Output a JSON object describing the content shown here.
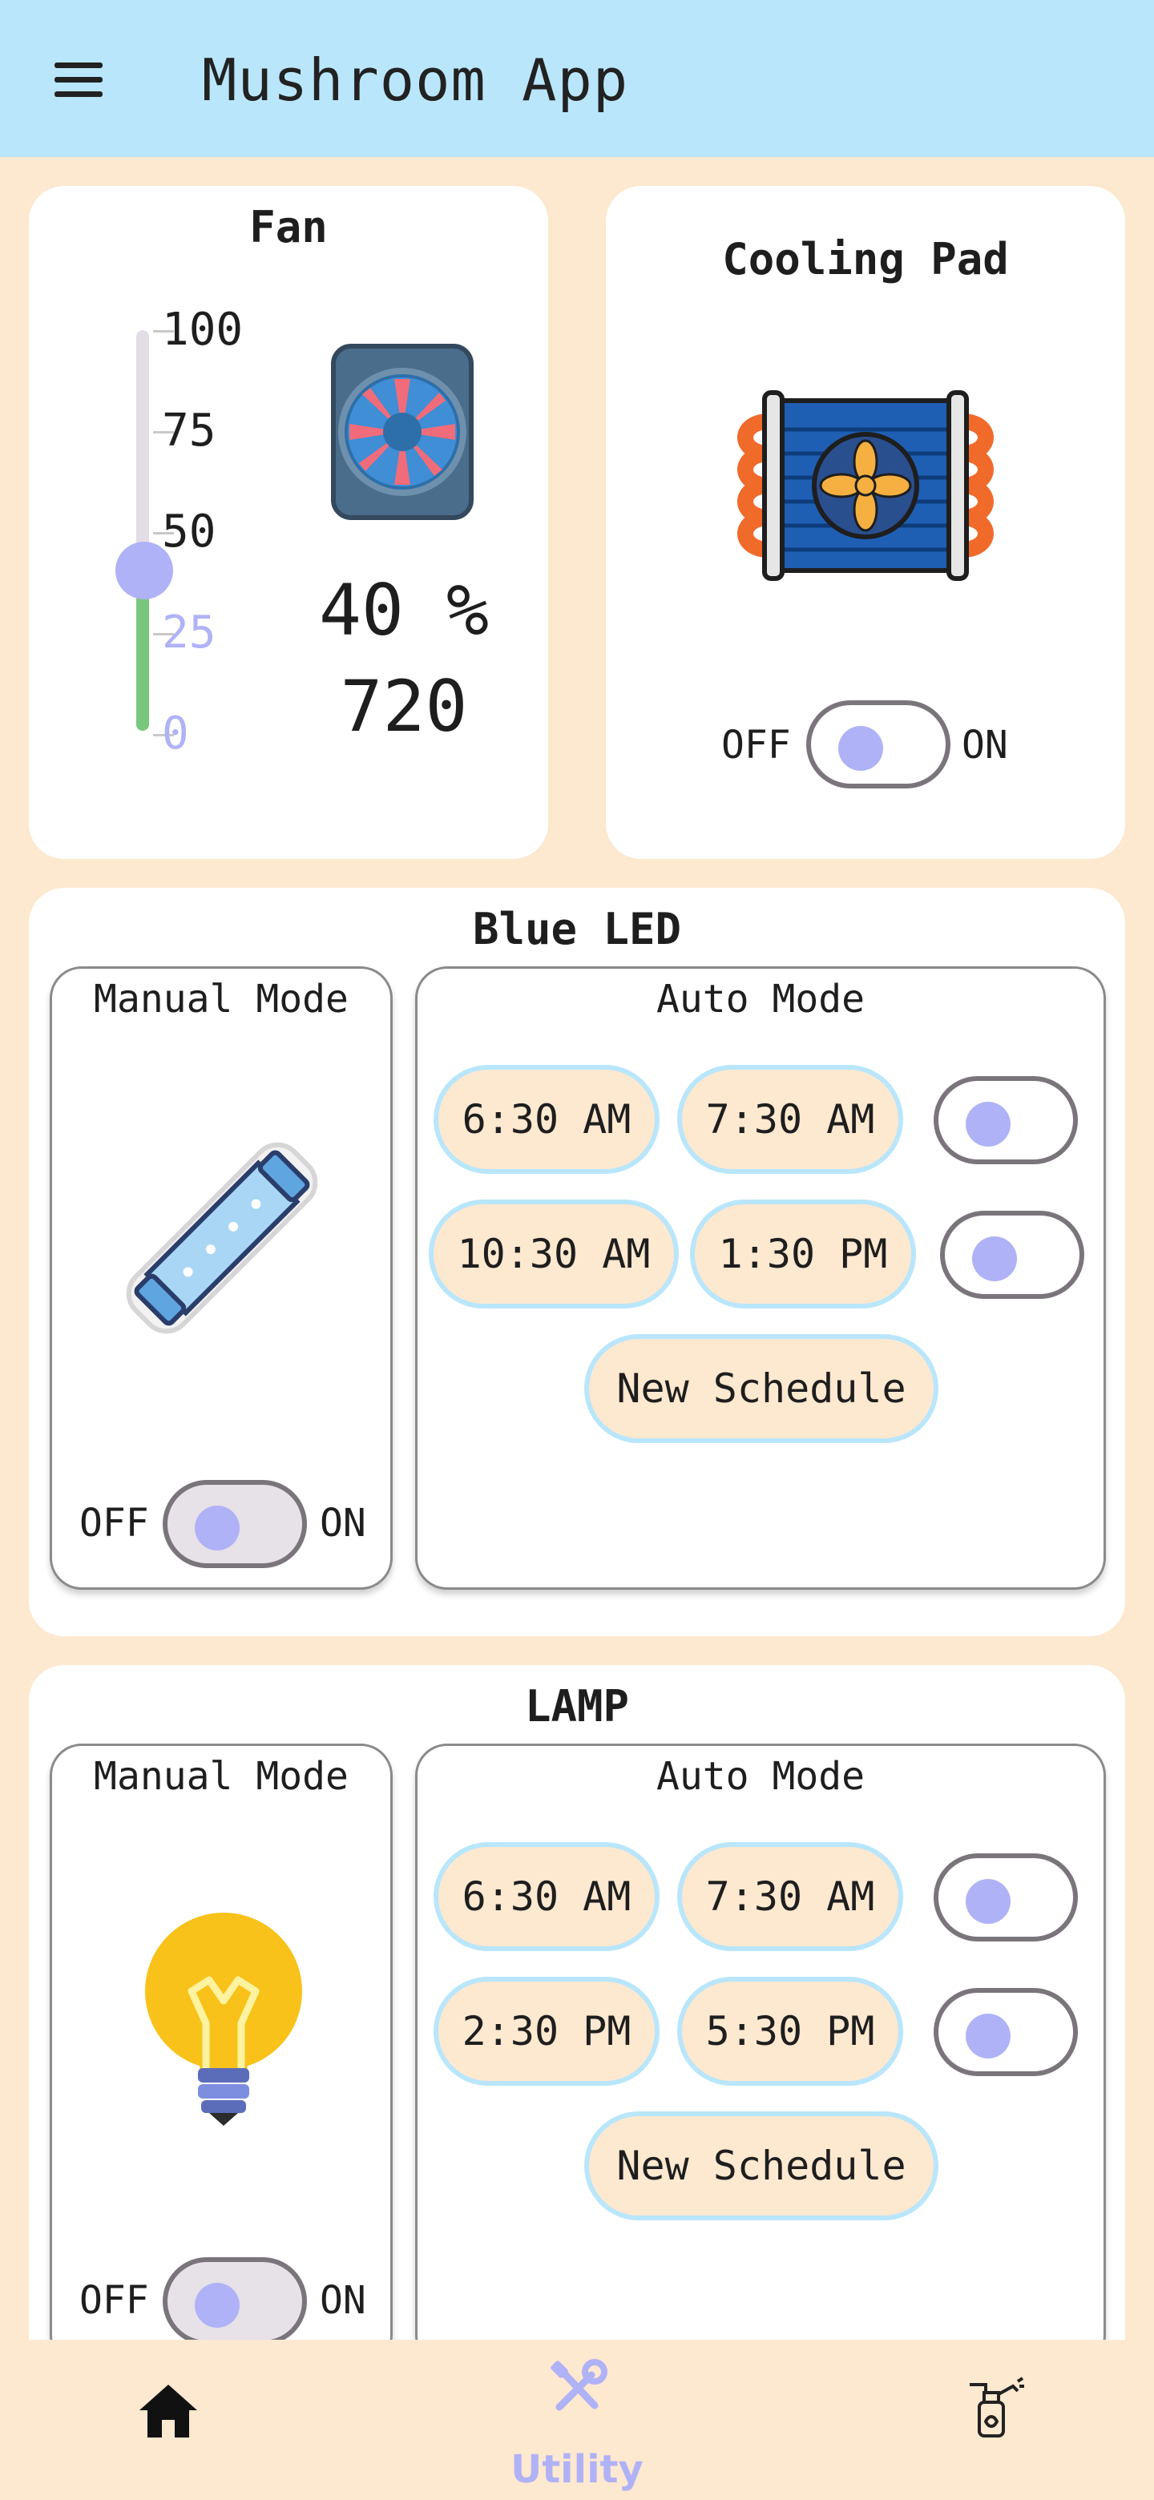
{
  "app": {
    "title": "Mushroom App"
  },
  "fan": {
    "title": "Fan",
    "slider_ticks": [
      "100",
      "75",
      "50",
      "25",
      "0"
    ],
    "level_percent": 40,
    "percent_text": "40 %",
    "speed_text": "720"
  },
  "cooling_pad": {
    "title": "Cooling Pad",
    "off_label": "OFF",
    "on_label": "ON"
  },
  "blue_led": {
    "title": "Blue LED",
    "manual": {
      "title": "Manual Mode",
      "off_label": "OFF",
      "on_label": "ON"
    },
    "auto": {
      "title": "Auto Mode",
      "schedules": [
        {
          "start": "6:30 AM",
          "end": "7:30 AM"
        },
        {
          "start": "10:30 AM",
          "end": "1:30 PM"
        }
      ],
      "new_schedule_label": "New Schedule"
    }
  },
  "lamp": {
    "title": "LAMP",
    "manual": {
      "title": "Manual Mode",
      "off_label": "OFF",
      "on_label": "ON"
    },
    "auto": {
      "title": "Auto Mode",
      "schedules": [
        {
          "start": "6:30 AM",
          "end": "7:30 AM"
        },
        {
          "start": "2:30 PM",
          "end": "5:30 PM"
        }
      ],
      "new_schedule_label": "New Schedule"
    }
  },
  "bottom_nav": {
    "items": [
      {
        "icon": "home-icon",
        "label": ""
      },
      {
        "icon": "tools-icon",
        "label": "Utility"
      },
      {
        "icon": "sprayer-icon",
        "label": ""
      }
    ]
  },
  "colors": {
    "appbar": "#b9e6fb",
    "background": "#fde8d0",
    "accent": "#b0b2f7",
    "slider_fill": "#79c77d"
  }
}
